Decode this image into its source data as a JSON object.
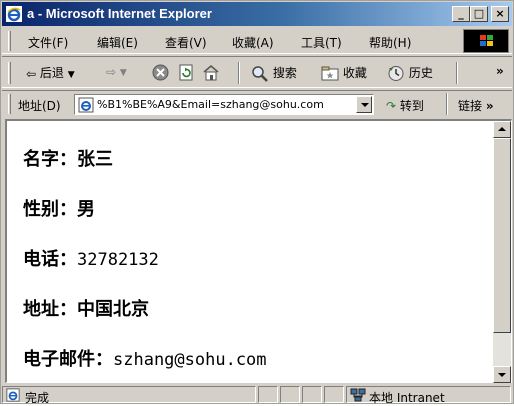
{
  "window": {
    "title": "a - Microsoft Internet Explorer",
    "controls": {
      "minimize": "_",
      "maximize": "□",
      "close": "×"
    }
  },
  "menu": {
    "items": [
      "文件(F)",
      "编辑(E)",
      "查看(V)",
      "收藏(A)",
      "工具(T)",
      "帮助(H)"
    ]
  },
  "toolbar": {
    "back": "后退",
    "search": "搜索",
    "favorites": "收藏",
    "history": "历史",
    "more": "»"
  },
  "address": {
    "label": "地址(D)",
    "value": "%B1%BE%A9&Email=szhang@sohu.com",
    "goto": "转到",
    "links": "链接",
    "links_more": "»"
  },
  "content": {
    "fields": [
      {
        "label": "名字：",
        "value": "张三"
      },
      {
        "label": "性别：",
        "value": "男"
      },
      {
        "label": "电话：",
        "value": "32782132"
      },
      {
        "label": "地址：",
        "value": "中国北京"
      },
      {
        "label": "电子邮件：",
        "value": "szhang@sohu.com"
      }
    ]
  },
  "status": {
    "text": "完成",
    "zone": "本地 Intranet"
  },
  "colors": {
    "title_start": "#0a246a",
    "title_end": "#a6caf0",
    "chrome": "#d4d0c8"
  }
}
